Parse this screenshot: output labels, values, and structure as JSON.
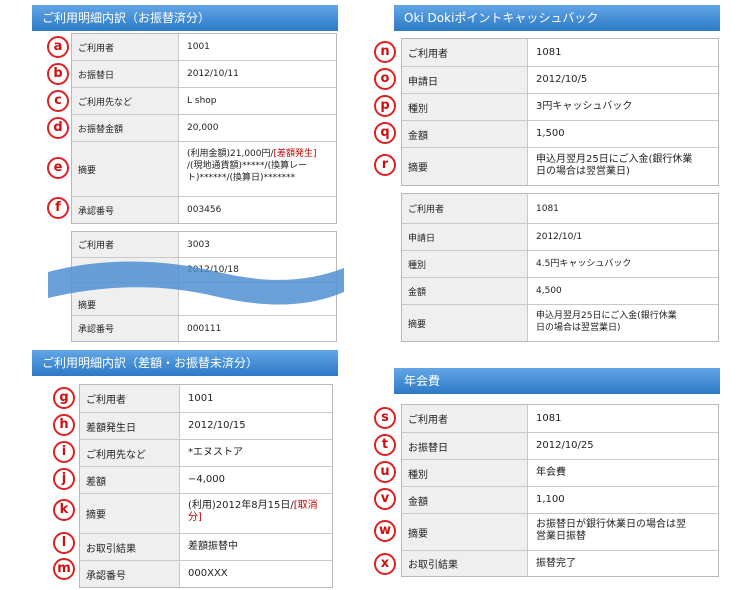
{
  "section1": {
    "title": "ご利用明細内訳（お振替済分）",
    "rows": [
      {
        "marker": "a",
        "label": "ご利用者",
        "value": "1001"
      },
      {
        "marker": "b",
        "label": "お振替日",
        "value": "2012/10/11"
      },
      {
        "marker": "c",
        "label": "ご利用先など",
        "value": "L shop"
      },
      {
        "marker": "d",
        "label": "お振替金額",
        "value": "20,000"
      },
      {
        "marker": "e",
        "label": "摘要",
        "value_lines": [
          "(利用金額)21,000円/",
          "[差額発生]",
          "/(現地通貨額)*****/(換算レー",
          "ト)******/(換算日)*******"
        ]
      },
      {
        "marker": "f",
        "label": "承認番号",
        "value": "003456"
      }
    ],
    "second_block": {
      "rows": [
        {
          "label": "ご利用者",
          "value": "3003"
        },
        {
          "label": "",
          "value": "2012/10/18"
        },
        {
          "label": "摘要",
          "value": ""
        },
        {
          "label": "承認番号",
          "value": "000111"
        }
      ]
    }
  },
  "section2": {
    "title": "Oki Dokiポイントキャッシュバック",
    "rows": [
      {
        "marker": "n",
        "label": "ご利用者",
        "value": "1081"
      },
      {
        "marker": "o",
        "label": "申請日",
        "value": "2012/10/5"
      },
      {
        "marker": "p",
        "label": "種別",
        "value": "3円キャッシュバック"
      },
      {
        "marker": "q",
        "label": "金額",
        "value": "1,500"
      },
      {
        "marker": "r",
        "label": "摘要",
        "value_lines": [
          "申込月翌月25日にご入金(銀行休業",
          "日の場合は翌営業日)"
        ]
      }
    ],
    "second_block": {
      "rows": [
        {
          "label": "ご利用者",
          "value": "1081"
        },
        {
          "label": "申請日",
          "value": "2012/10/1"
        },
        {
          "label": "種別",
          "value": "4.5円キャッシュバック"
        },
        {
          "label": "金額",
          "value": "4,500"
        },
        {
          "label": "摘要",
          "value_lines": [
            "申込月翌月25日にご入金(銀行休業",
            "日の場合は翌営業日)"
          ]
        }
      ]
    }
  },
  "section3": {
    "title": "ご利用明細内訳（差額・お振替未済分）",
    "rows": [
      {
        "marker": "g",
        "label": "ご利用者",
        "value": "1001"
      },
      {
        "marker": "h",
        "label": "差額発生日",
        "value": "2012/10/15"
      },
      {
        "marker": "i",
        "label": "ご利用先など",
        "value": "*エヌストア"
      },
      {
        "marker": "j",
        "label": "差額",
        "value": "−4,000"
      },
      {
        "marker": "k",
        "label": "摘要",
        "value_main": "(利用)2012年8月15日/",
        "value_red": "[取消分]"
      },
      {
        "marker": "l",
        "label": "お取引結果",
        "value": "差額振替中"
      },
      {
        "marker": "m",
        "label": "承認番号",
        "value": "000XXX"
      }
    ]
  },
  "section4": {
    "title": "年会費",
    "rows": [
      {
        "marker": "s",
        "label": "ご利用者",
        "value": "1081"
      },
      {
        "marker": "t",
        "label": "お振替日",
        "value": "2012/10/25"
      },
      {
        "marker": "u",
        "label": "種別",
        "value": "年会費"
      },
      {
        "marker": "v",
        "label": "金額",
        "value": "1,100"
      },
      {
        "marker": "w",
        "label": "摘要",
        "value_lines": [
          "お振替日が銀行休業日の場合は翌",
          "営業日振替"
        ]
      },
      {
        "marker": "x",
        "label": "お取引結果",
        "value": "振替完了"
      }
    ]
  },
  "colors": {
    "header_top": "#62a6e6",
    "header_bottom": "#2c79c6",
    "marker_red": "#e02020",
    "note_red": "#c00000",
    "label_bg": "#efefef",
    "wave_blue": "#4f8fd0"
  }
}
